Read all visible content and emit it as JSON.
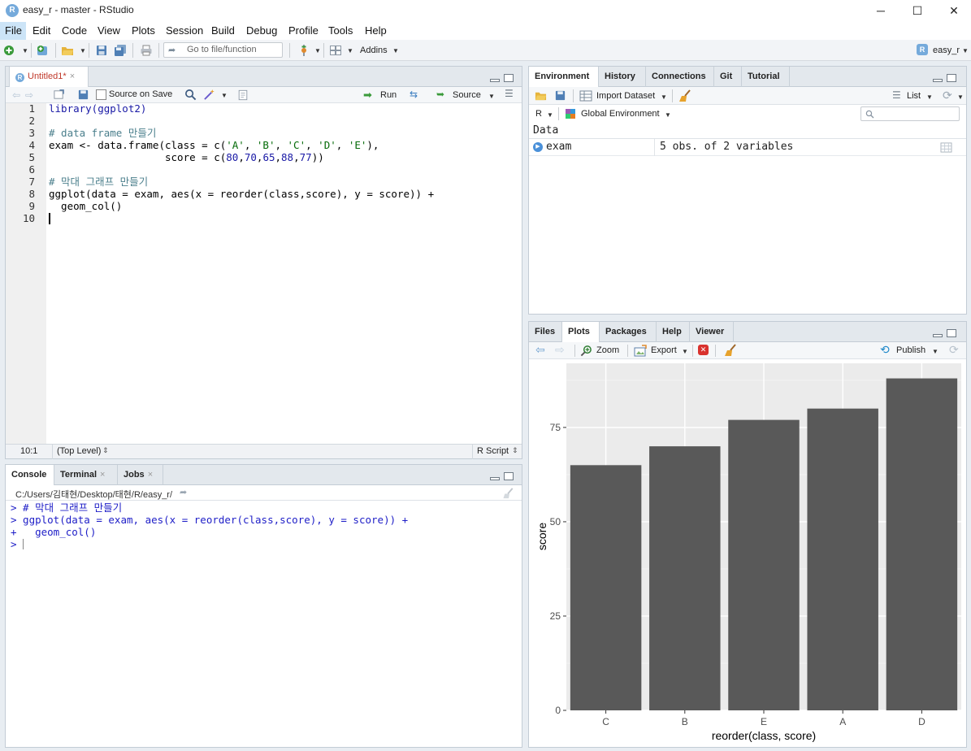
{
  "window": {
    "title": "easy_r - master - RStudio",
    "app_icon_letter": "R",
    "minimize": "─",
    "maximize": "☐",
    "close": "✕"
  },
  "menu": [
    "File",
    "Edit",
    "Code",
    "View",
    "Plots",
    "Session",
    "Build",
    "Debug",
    "Profile",
    "Tools",
    "Help"
  ],
  "toolbar": {
    "goto_placeholder": "Go to file/function",
    "addins_label": "Addins",
    "project_label": "easy_r",
    "project_icon_letter": "R"
  },
  "editor": {
    "tab_label": "Untitled1*",
    "source_on_save": "Source on Save",
    "run_label": "Run",
    "source_label": "Source",
    "line_numbers": [
      "1",
      "2",
      "3",
      "4",
      "5",
      "6",
      "7",
      "8",
      "9",
      "10"
    ],
    "cursor_position": "10:1",
    "scope": "(Top Level)",
    "file_type": "R Script",
    "code": [
      [
        {
          "t": "library(ggplot2)",
          "c": "kw-fn"
        }
      ],
      [],
      [
        {
          "t": "# data frame 만들기",
          "c": "cmt"
        }
      ],
      [
        {
          "t": "exam <- data.frame(class = c(",
          "c": "plain"
        },
        {
          "t": "'A'",
          "c": "str"
        },
        {
          "t": ", ",
          "c": "plain"
        },
        {
          "t": "'B'",
          "c": "str"
        },
        {
          "t": ", ",
          "c": "plain"
        },
        {
          "t": "'C'",
          "c": "str"
        },
        {
          "t": ", ",
          "c": "plain"
        },
        {
          "t": "'D'",
          "c": "str"
        },
        {
          "t": ", ",
          "c": "plain"
        },
        {
          "t": "'E'",
          "c": "str"
        },
        {
          "t": "),",
          "c": "plain"
        }
      ],
      [
        {
          "t": "                   score = c(",
          "c": "plain"
        },
        {
          "t": "80",
          "c": "num"
        },
        {
          "t": ",",
          "c": "plain"
        },
        {
          "t": "70",
          "c": "num"
        },
        {
          "t": ",",
          "c": "plain"
        },
        {
          "t": "65",
          "c": "num"
        },
        {
          "t": ",",
          "c": "plain"
        },
        {
          "t": "88",
          "c": "num"
        },
        {
          "t": ",",
          "c": "plain"
        },
        {
          "t": "77",
          "c": "num"
        },
        {
          "t": "))",
          "c": "plain"
        }
      ],
      [],
      [
        {
          "t": "# 막대 그래프 만들기",
          "c": "cmt"
        }
      ],
      [
        {
          "t": "ggplot(data = exam, aes(x = reorder(class,score), y = score)) +",
          "c": "plain"
        }
      ],
      [
        {
          "t": "  geom_col()",
          "c": "plain"
        }
      ],
      []
    ]
  },
  "console": {
    "tabs": [
      "Console",
      "Terminal",
      "Jobs"
    ],
    "path": "C:/Users/김태현/Desktop/태현/R/easy_r/",
    "lines": [
      "> # 막대 그래프 만들기",
      "> ggplot(data = exam, aes(x = reorder(class,score), y = score)) +",
      "+   geom_col()",
      "> "
    ]
  },
  "environment": {
    "tabs": [
      "Environment",
      "History",
      "Connections",
      "Git",
      "Tutorial"
    ],
    "import_label": "Import Dataset",
    "list_label": "List",
    "lang_label": "R",
    "scope_label": "Global Environment",
    "section_header": "Data",
    "rows": [
      {
        "name": "exam",
        "value": "5 obs. of 2 variables"
      }
    ]
  },
  "files_pane": {
    "tabs": [
      "Files",
      "Plots",
      "Packages",
      "Help",
      "Viewer"
    ],
    "zoom_label": "Zoom",
    "export_label": "Export",
    "publish_label": "Publish"
  },
  "chart_data": {
    "type": "bar",
    "categories": [
      "C",
      "B",
      "E",
      "A",
      "D"
    ],
    "values": [
      65,
      70,
      77,
      80,
      88
    ],
    "xlabel": "reorder(class, score)",
    "ylabel": "score",
    "ylim": [
      0,
      92
    ],
    "yticks": [
      0,
      25,
      50,
      75
    ],
    "bar_color": "#595959",
    "panel_color": "#ebebeb",
    "grid": true
  },
  "colors": {
    "accent": "#75aadb",
    "tab_modified": "#c0392b",
    "code_keyword": "#1a1aa6",
    "code_string": "#036a07",
    "code_comment": "#4b7f8c",
    "console_text": "#1d1dc7"
  }
}
